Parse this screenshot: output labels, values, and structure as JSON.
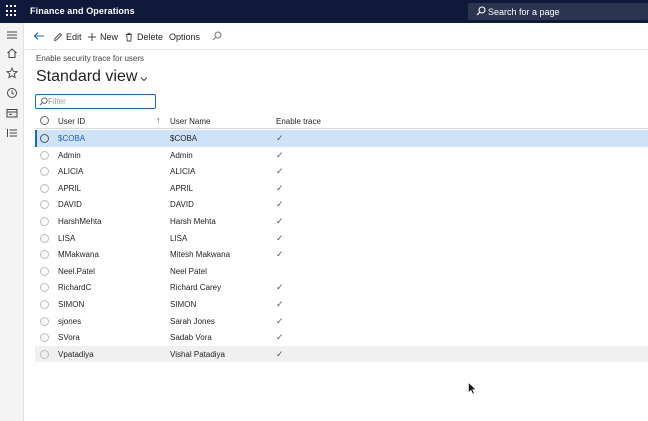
{
  "topbar": {
    "app_title": "Finance and Operations",
    "search_placeholder": "Search for a page"
  },
  "navrail": {
    "items": [
      "menu-icon",
      "home-icon",
      "star-icon",
      "clock-icon",
      "workspace-icon",
      "list-icon"
    ]
  },
  "actionpane": {
    "edit": "Edit",
    "new": "New",
    "delete": "Delete",
    "options": "Options"
  },
  "page": {
    "caption": "Enable security trace for users",
    "view_title": "Standard view",
    "filter_placeholder": "Filter"
  },
  "grid": {
    "columns": {
      "user_id": "User ID",
      "sort_indicator": "↑",
      "user_name": "User Name",
      "enable_trace": "Enable trace"
    },
    "check_glyph": "✓",
    "rows": [
      {
        "user_id": "$COBA",
        "user_name": "$COBA",
        "trace": "✓"
      },
      {
        "user_id": "Admin",
        "user_name": "Admin",
        "trace": "✓"
      },
      {
        "user_id": "ALICIA",
        "user_name": "ALICIA",
        "trace": "✓"
      },
      {
        "user_id": "APRIL",
        "user_name": "APRIL",
        "trace": "✓"
      },
      {
        "user_id": "DAVID",
        "user_name": "DAVID",
        "trace": "✓"
      },
      {
        "user_id": "HarshMehta",
        "user_name": "Harsh Mehta",
        "trace": "✓"
      },
      {
        "user_id": "LISA",
        "user_name": "LISA",
        "trace": "✓"
      },
      {
        "user_id": "MMakwana",
        "user_name": "Mitesh Makwana",
        "trace": "✓"
      },
      {
        "user_id": "Neel.Patel",
        "user_name": "Neel Patel",
        "trace": ""
      },
      {
        "user_id": "RichardC",
        "user_name": "Richard Carey",
        "trace": "✓"
      },
      {
        "user_id": "SIMON",
        "user_name": "SIMON",
        "trace": "✓"
      },
      {
        "user_id": "sjones",
        "user_name": "Sarah Jones",
        "trace": "✓"
      },
      {
        "user_id": "SVora",
        "user_name": "Sadab Vora",
        "trace": "✓"
      },
      {
        "user_id": "Vpatadiya",
        "user_name": "Vishal Patadiya",
        "trace": "✓"
      }
    ]
  },
  "colors": {
    "topbar_bg": "#0f1a3a",
    "accent": "#1967c0",
    "selected_row_bg": "#cfe3f8"
  }
}
